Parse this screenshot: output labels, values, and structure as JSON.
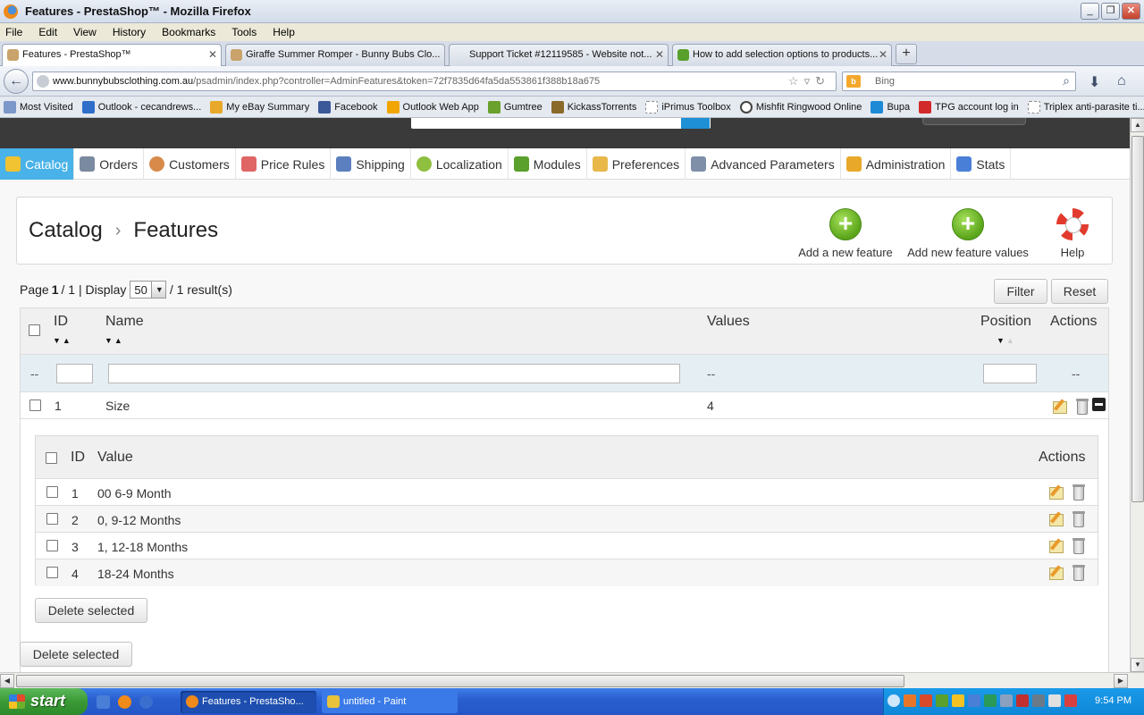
{
  "window": {
    "title": "Features - PrestaShop™ - Mozilla Firefox"
  },
  "menu": [
    "File",
    "Edit",
    "View",
    "History",
    "Bookmarks",
    "Tools",
    "Help"
  ],
  "tabs": [
    {
      "label": "Features - PrestaShop™"
    },
    {
      "label": "Giraffe Summer Romper - Bunny Bubs Clo..."
    },
    {
      "label": "Support Ticket #12119585 - Website not..."
    },
    {
      "label": "How to add selection options to products..."
    }
  ],
  "nav": {
    "url_domain": "www.bunnybubsclothing.com.au",
    "url_path": "/psadmin/index.php?controller=AdminFeatures&token=72f7835d64fa5da553861f388b18a675",
    "search_placeholder": "Bing"
  },
  "bookmarks": [
    "Most Visited",
    "Outlook - cecandrews...",
    "My eBay Summary",
    "Facebook",
    "Outlook Web App",
    "Gumtree",
    "KickassTorrents",
    "iPrimus Toolbox",
    "Mishfit Ringwood Online",
    "Bupa",
    "TPG account log in",
    "Triplex anti-parasite ti..."
  ],
  "admin_nav": [
    {
      "label": "Catalog",
      "color": "#f1c232"
    },
    {
      "label": "Orders",
      "color": "#7a8aa0"
    },
    {
      "label": "Customers",
      "color": "#d88a4a"
    },
    {
      "label": "Price Rules",
      "color": "#e06666"
    },
    {
      "label": "Shipping",
      "color": "#5b7fbf"
    },
    {
      "label": "Localization",
      "color": "#8fbf3f"
    },
    {
      "label": "Modules",
      "color": "#5aa02c"
    },
    {
      "label": "Preferences",
      "color": "#e8b84a"
    },
    {
      "label": "Advanced Parameters",
      "color": "#7f8fa8"
    },
    {
      "label": "Administration",
      "color": "#e8a82a"
    },
    {
      "label": "Stats",
      "color": "#4a7fd8"
    }
  ],
  "breadcrumb": {
    "parent": "Catalog",
    "current": "Features"
  },
  "toolbar": {
    "add_feature": "Add a new feature",
    "add_values": "Add new feature values",
    "help": "Help"
  },
  "pagination": {
    "page_label": "Page",
    "page": "1",
    "of_pages": "/ 1 | Display",
    "display": "50",
    "results": "/ 1 result(s)"
  },
  "buttons": {
    "filter": "Filter",
    "reset": "Reset",
    "delete_selected": "Delete selected"
  },
  "table": {
    "headers": {
      "id": "ID",
      "name": "Name",
      "values": "Values",
      "position": "Position",
      "actions": "Actions"
    },
    "filter_placeholder": "--",
    "rows": [
      {
        "id": "1",
        "name": "Size",
        "values": "4"
      }
    ]
  },
  "subtable": {
    "headers": {
      "id": "ID",
      "value": "Value",
      "actions": "Actions"
    },
    "rows": [
      {
        "id": "1",
        "value": "00 6-9 Month"
      },
      {
        "id": "2",
        "value": "0, 9-12 Months"
      },
      {
        "id": "3",
        "value": "1, 12-18 Months"
      },
      {
        "id": "4",
        "value": "18-24 Months"
      }
    ]
  },
  "taskbar": {
    "start": "start",
    "items": [
      {
        "label": "Features - PrestaSho..."
      },
      {
        "label": "untitled - Paint"
      }
    ],
    "clock": "9:54 PM"
  }
}
